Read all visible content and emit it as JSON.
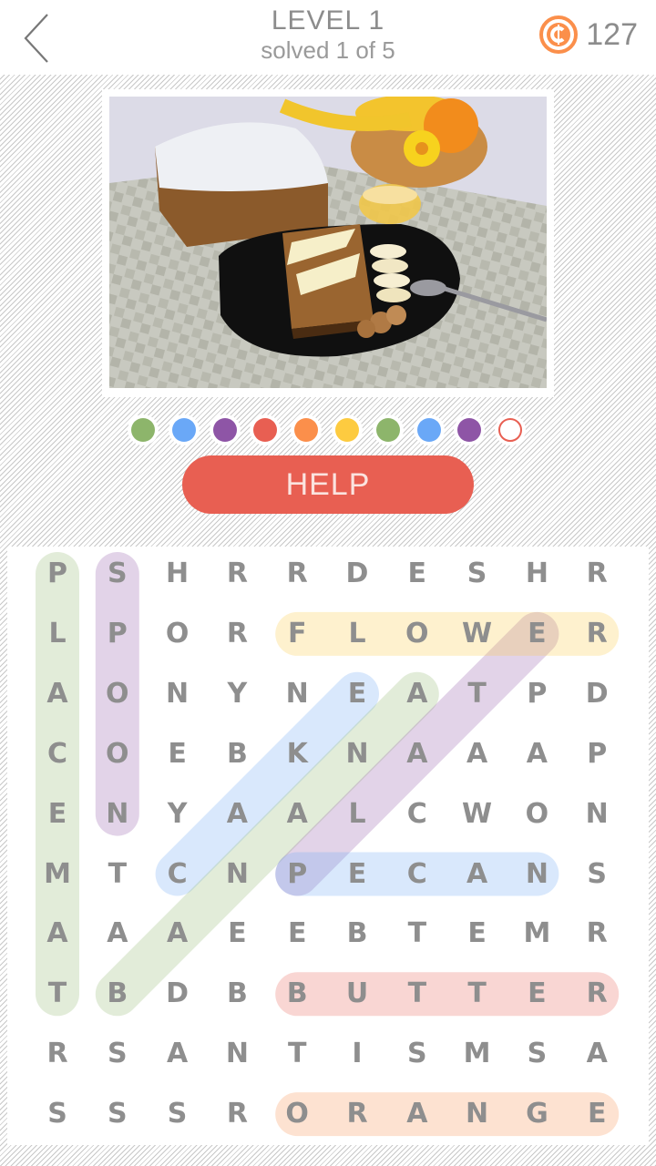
{
  "header": {
    "back_icon": "chevron-left-icon",
    "title": "LEVEL 1",
    "subtitle": "solved 1 of 5",
    "coin_icon": "coin-icon",
    "coin_symbol": "₵",
    "coins": "127"
  },
  "puzzle_image": {
    "alt": "Banana bread loaf with sliced bread, cheese, banana slices, walnuts, honey, spoon, flower and fruit basket on a placemat"
  },
  "progress_dots": [
    {
      "color": "#8db56b",
      "filled": true
    },
    {
      "color": "#6aa8f7",
      "filled": true
    },
    {
      "color": "#8e55a6",
      "filled": true
    },
    {
      "color": "#e85f52",
      "filled": true
    },
    {
      "color": "#fb8f4b",
      "filled": true
    },
    {
      "color": "#fdcb40",
      "filled": true
    },
    {
      "color": "#8db56b",
      "filled": true
    },
    {
      "color": "#6aa8f7",
      "filled": true
    },
    {
      "color": "#8e55a6",
      "filled": true
    },
    {
      "color": "#e85f52",
      "filled": false
    }
  ],
  "help_button": {
    "label": "HELP"
  },
  "grid": {
    "rows": [
      [
        "P",
        "S",
        "H",
        "R",
        "R",
        "D",
        "E",
        "S",
        "H",
        "R"
      ],
      [
        "L",
        "P",
        "O",
        "R",
        "F",
        "L",
        "O",
        "W",
        "E",
        "R"
      ],
      [
        "A",
        "O",
        "N",
        "Y",
        "N",
        "E",
        "A",
        "T",
        "P",
        "D"
      ],
      [
        "C",
        "O",
        "E",
        "B",
        "K",
        "N",
        "A",
        "A",
        "A",
        "P"
      ],
      [
        "E",
        "N",
        "Y",
        "A",
        "A",
        "L",
        "C",
        "W",
        "O",
        "N"
      ],
      [
        "M",
        "T",
        "C",
        "N",
        "P",
        "E",
        "C",
        "A",
        "N",
        "S"
      ],
      [
        "A",
        "A",
        "A",
        "E",
        "E",
        "B",
        "T",
        "E",
        "M",
        "R"
      ],
      [
        "T",
        "B",
        "D",
        "B",
        "B",
        "U",
        "T",
        "T",
        "E",
        "R"
      ],
      [
        "R",
        "S",
        "A",
        "N",
        "T",
        "I",
        "S",
        "M",
        "S",
        "A"
      ],
      [
        "S",
        "S",
        "S",
        "R",
        "O",
        "R",
        "A",
        "N",
        "G",
        "E"
      ]
    ]
  },
  "found_words": [
    {
      "word": "PLACEMAT",
      "color": "#8db56b",
      "start": [
        0,
        0
      ],
      "end": [
        7,
        0
      ]
    },
    {
      "word": "SPOON",
      "color": "#8e55a6",
      "start": [
        0,
        1
      ],
      "end": [
        4,
        1
      ]
    },
    {
      "word": "CAKE",
      "color": "#6aa8f7",
      "start": [
        5,
        2
      ],
      "end": [
        2,
        5
      ]
    },
    {
      "word": "BANANA",
      "color": "#8db56b",
      "start": [
        7,
        1
      ],
      "end": [
        2,
        6
      ]
    },
    {
      "word": "PLATE",
      "color": "#8e55a6",
      "start": [
        5,
        4
      ],
      "end": [
        1,
        8
      ]
    },
    {
      "word": "FLOWER",
      "color": "#fdcb40",
      "start": [
        1,
        4
      ],
      "end": [
        1,
        9
      ]
    },
    {
      "word": "PECANS",
      "color": "#6aa8f7",
      "start": [
        5,
        4
      ],
      "end": [
        5,
        8
      ]
    },
    {
      "word": "BUTTER",
      "color": "#e85f52",
      "start": [
        7,
        4
      ],
      "end": [
        7,
        9
      ]
    },
    {
      "word": "ORANGE",
      "color": "#fb8f4b",
      "start": [
        9,
        4
      ],
      "end": [
        9,
        9
      ]
    }
  ]
}
